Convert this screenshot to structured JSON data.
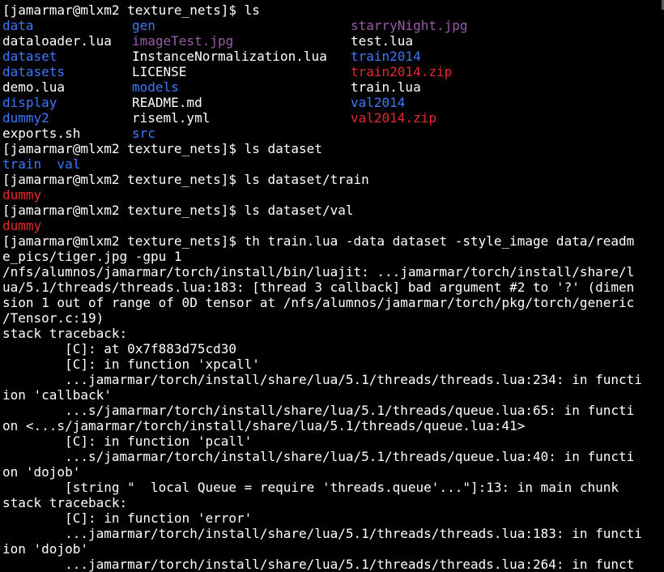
{
  "colors": {
    "foreground": "#ffffff",
    "background": "#000000",
    "directory": "#3b78ff",
    "image": "#9a5aa8",
    "archive": "#e8282d",
    "error_text": "#e8282d"
  },
  "terminal": {
    "lines": [
      {
        "segs": [
          {
            "text": "[jamarmar@mlxm2 texture_nets]$ ls",
            "c": "fg"
          }
        ]
      },
      {
        "segs": [
          {
            "text": "data",
            "c": "dir",
            "col": 0
          },
          {
            "text": "gen",
            "c": "dir",
            "col": 1
          },
          {
            "text": "starryNight.jpg",
            "c": "img",
            "col": 2
          }
        ]
      },
      {
        "segs": [
          {
            "text": "dataloader.lua",
            "c": "fg",
            "col": 0
          },
          {
            "text": "imageTest.jpg",
            "c": "img",
            "col": 1
          },
          {
            "text": "test.lua",
            "c": "fg",
            "col": 2
          }
        ]
      },
      {
        "segs": [
          {
            "text": "dataset",
            "c": "dir",
            "col": 0
          },
          {
            "text": "InstanceNormalization.lua",
            "c": "fg",
            "col": 1
          },
          {
            "text": "train2014",
            "c": "dir",
            "col": 2
          }
        ]
      },
      {
        "segs": [
          {
            "text": "datasets",
            "c": "dir",
            "col": 0
          },
          {
            "text": "LICENSE",
            "c": "fg",
            "col": 1
          },
          {
            "text": "train2014.zip",
            "c": "zip",
            "col": 2
          }
        ]
      },
      {
        "segs": [
          {
            "text": "demo.lua",
            "c": "fg",
            "col": 0
          },
          {
            "text": "models",
            "c": "dir",
            "col": 1
          },
          {
            "text": "train.lua",
            "c": "fg",
            "col": 2
          }
        ]
      },
      {
        "segs": [
          {
            "text": "display",
            "c": "dir",
            "col": 0
          },
          {
            "text": "README.md",
            "c": "fg",
            "col": 1
          },
          {
            "text": "val2014",
            "c": "dir",
            "col": 2
          }
        ]
      },
      {
        "segs": [
          {
            "text": "dummy2",
            "c": "dir",
            "col": 0
          },
          {
            "text": "riseml.yml",
            "c": "fg",
            "col": 1
          },
          {
            "text": "val2014.zip",
            "c": "zip",
            "col": 2
          }
        ]
      },
      {
        "segs": [
          {
            "text": "exports.sh",
            "c": "fg",
            "col": 0
          },
          {
            "text": "src",
            "c": "dir",
            "col": 1
          }
        ]
      },
      {
        "segs": [
          {
            "text": "[jamarmar@mlxm2 texture_nets]$ ls dataset",
            "c": "fg"
          }
        ]
      },
      {
        "segs": [
          {
            "text": "train  val",
            "c": "dir"
          }
        ]
      },
      {
        "segs": [
          {
            "text": "[jamarmar@mlxm2 texture_nets]$ ls dataset/train",
            "c": "fg"
          }
        ]
      },
      {
        "segs": [
          {
            "text": "dummy",
            "c": "zip"
          }
        ]
      },
      {
        "segs": [
          {
            "text": "[jamarmar@mlxm2 texture_nets]$ ls dataset/val",
            "c": "fg"
          }
        ]
      },
      {
        "segs": [
          {
            "text": "dummy",
            "c": "zip"
          }
        ]
      },
      {
        "segs": [
          {
            "text": "[jamarmar@mlxm2 texture_nets]$ th train.lua -data dataset -style_image data/readm",
            "c": "fg"
          }
        ]
      },
      {
        "segs": [
          {
            "text": "e_pics/tiger.jpg -gpu 1",
            "c": "fg"
          }
        ]
      },
      {
        "segs": [
          {
            "text": "/nfs/alumnos/jamarmar/torch/install/bin/luajit: ...jamarmar/torch/install/share/l",
            "c": "fg"
          }
        ]
      },
      {
        "segs": [
          {
            "text": "ua/5.1/threads/threads.lua:183: [thread 3 callback] bad argument #2 to '?' (dimen",
            "c": "fg"
          }
        ]
      },
      {
        "segs": [
          {
            "text": "sion 1 out of range of 0D tensor at /nfs/alumnos/jamarmar/torch/pkg/torch/generic",
            "c": "fg"
          }
        ]
      },
      {
        "segs": [
          {
            "text": "/Tensor.c:19)",
            "c": "fg"
          }
        ]
      },
      {
        "segs": [
          {
            "text": "stack traceback:",
            "c": "fg"
          }
        ]
      },
      {
        "segs": [
          {
            "text": "        [C]: at 0x7f883d75cd30",
            "c": "fg"
          }
        ]
      },
      {
        "segs": [
          {
            "text": "        [C]: in function 'xpcall'",
            "c": "fg"
          }
        ]
      },
      {
        "segs": [
          {
            "text": "        ...jamarmar/torch/install/share/lua/5.1/threads/threads.lua:234: in functi",
            "c": "fg"
          }
        ]
      },
      {
        "segs": [
          {
            "text": "ion 'callback'",
            "c": "fg"
          }
        ]
      },
      {
        "segs": [
          {
            "text": "        ...s/jamarmar/torch/install/share/lua/5.1/threads/queue.lua:65: in functi",
            "c": "fg"
          }
        ]
      },
      {
        "segs": [
          {
            "text": "on <...s/jamarmar/torch/install/share/lua/5.1/threads/queue.lua:41>",
            "c": "fg"
          }
        ]
      },
      {
        "segs": [
          {
            "text": "        [C]: in function 'pcall'",
            "c": "fg"
          }
        ]
      },
      {
        "segs": [
          {
            "text": "        ...s/jamarmar/torch/install/share/lua/5.1/threads/queue.lua:40: in functi",
            "c": "fg"
          }
        ]
      },
      {
        "segs": [
          {
            "text": "on 'dojob'",
            "c": "fg"
          }
        ]
      },
      {
        "segs": [
          {
            "text": "        [string \"  local Queue = require 'threads.queue'...\"]:13: in main chunk",
            "c": "fg"
          }
        ]
      },
      {
        "segs": [
          {
            "text": "stack traceback:",
            "c": "fg"
          }
        ]
      },
      {
        "segs": [
          {
            "text": "        [C]: in function 'error'",
            "c": "fg"
          }
        ]
      },
      {
        "segs": [
          {
            "text": "        ...jamarmar/torch/install/share/lua/5.1/threads/threads.lua:183: in functi",
            "c": "fg"
          }
        ]
      },
      {
        "segs": [
          {
            "text": "ion 'dojob'",
            "c": "fg"
          }
        ]
      },
      {
        "segs": [
          {
            "text": "        ...jamarmar/torch/install/share/lua/5.1/threads/threads.lua:264: in funct",
            "c": "fg"
          }
        ]
      }
    ]
  }
}
